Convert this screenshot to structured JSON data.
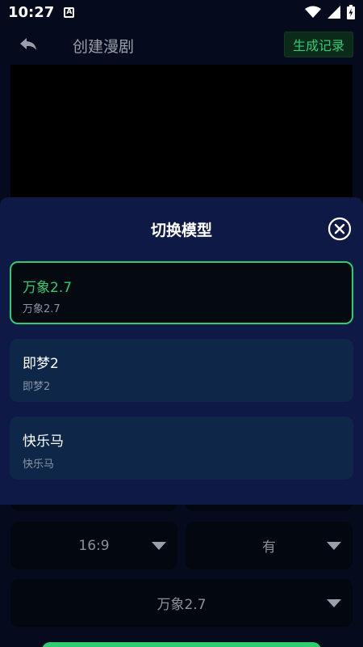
{
  "status_bar": {
    "time": "10:27",
    "notification_icon": "accessibility-a-icon",
    "icons": [
      "wifi-icon",
      "signal-icon",
      "battery-icon"
    ]
  },
  "header": {
    "title": "创建漫剧",
    "records_button": "生成记录",
    "back_icon": "back-arrow-icon"
  },
  "form": {
    "aspect_ratio": "16:9",
    "audio": "有",
    "model": "万象2.7"
  },
  "modal": {
    "title": "切换模型",
    "close_icon": "close-circle-icon",
    "options": [
      {
        "name": "万象2.7",
        "subtitle": "万象2.7",
        "selected": true
      },
      {
        "name": "即梦2",
        "subtitle": "即梦2",
        "selected": false
      },
      {
        "name": "快乐马",
        "subtitle": "快乐马",
        "selected": false
      }
    ]
  },
  "colors": {
    "accent": "#2ecc71",
    "background": "#050b1c",
    "sheet": "#0e1a45",
    "option_card": "#0e2748"
  }
}
